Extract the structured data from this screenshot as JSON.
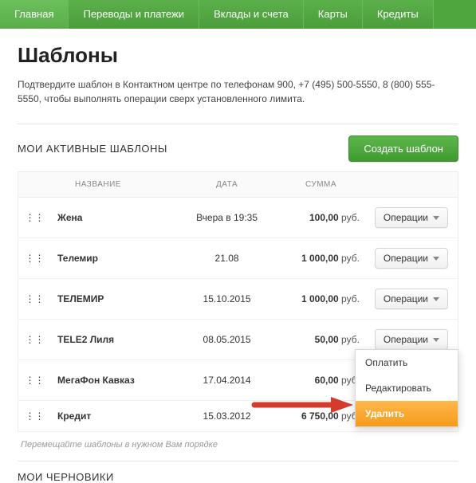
{
  "nav": {
    "items": [
      "Главная",
      "Переводы и платежи",
      "Вклады и счета",
      "Карты",
      "Кредиты"
    ]
  },
  "page": {
    "title": "Шаблоны",
    "info": "Подтвердите шаблон в Контактном центре по телефонам 900, +7 (495) 500-5550, 8 (800) 555-5550, чтобы выполнять операции сверх установленного лимита."
  },
  "active_section": {
    "title": "МОИ АКТИВНЫЕ ШАБЛОНЫ",
    "create_btn": "Создать шаблон",
    "columns": {
      "name": "НАЗВАНИЕ",
      "date": "ДАТА",
      "sum": "СУММА"
    },
    "op_label": "Операции",
    "currency": "руб.",
    "rows": [
      {
        "name": "Жена",
        "date": "Вчера в 19:35",
        "sum": "100,00"
      },
      {
        "name": "Телемир",
        "date": "21.08",
        "sum": "1 000,00"
      },
      {
        "name": "ТЕЛЕМИР",
        "date": "15.10.2015",
        "sum": "1 000,00"
      },
      {
        "name": "TELE2 Лиля",
        "date": "08.05.2015",
        "sum": "50,00"
      },
      {
        "name": "МегаФон Кавказ",
        "date": "17.04.2014",
        "sum": "60,00"
      },
      {
        "name": "Кредит",
        "date": "15.03.2012",
        "sum": "6 750,00"
      }
    ],
    "hint": "Перемещайте шаблоны в нужном Вам порядке"
  },
  "drafts_section": {
    "title": "МОИ ЧЕРНОВИКИ"
  },
  "dropdown": {
    "pay": "Оплатить",
    "edit": "Редактировать",
    "delete": "Удалить"
  },
  "colors": {
    "accent_green": "#4fa63f",
    "accent_orange": "#f59a1a",
    "arrow_red": "#d43b2a"
  }
}
